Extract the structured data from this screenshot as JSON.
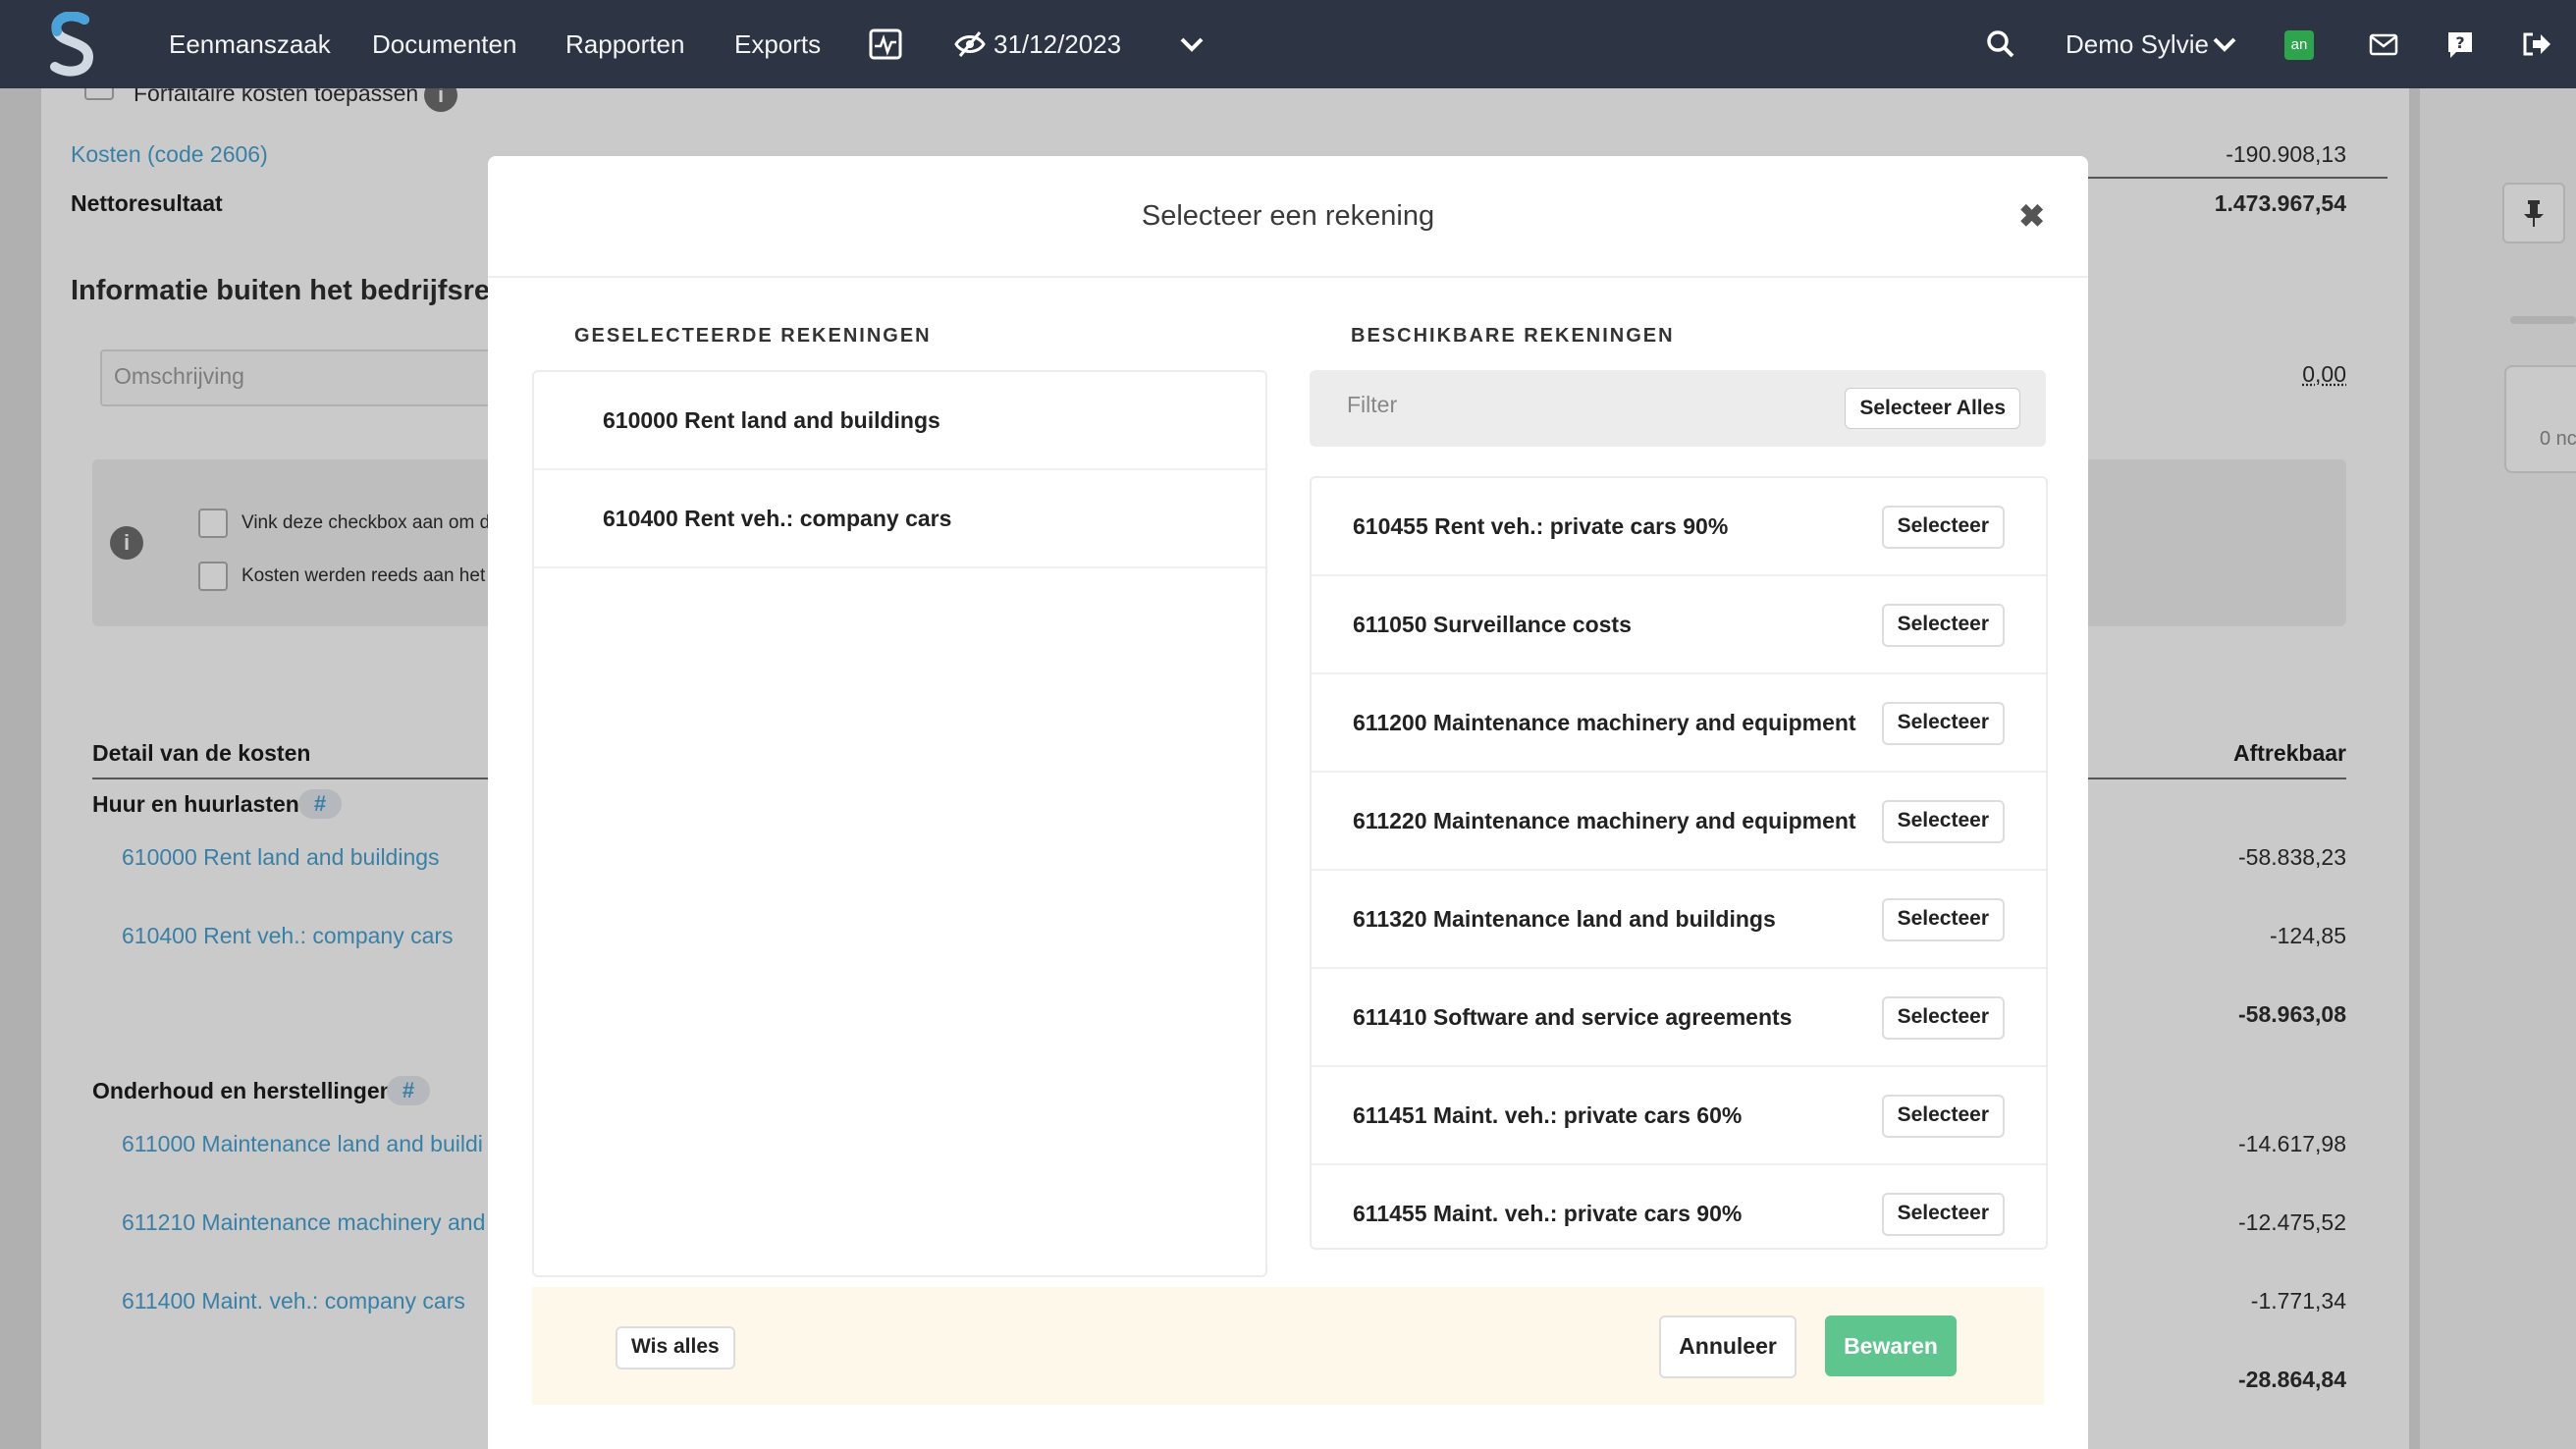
{
  "nav": {
    "items": [
      "Eenmanszaak",
      "Documenten",
      "Rapporten",
      "Exports"
    ],
    "date": "31/12/2023",
    "user": "Demo Sylvie",
    "badge": "an"
  },
  "background": {
    "forfaitaire": "Forfaitaire kosten toepassen",
    "kosten_link": "Kosten (code 2606)",
    "kosten_value": "-190.908,13",
    "netto_label": "Nettoresultaat",
    "netto_value": "1.473.967,54",
    "info_heading": "Informatie buiten het bedrijfsresult",
    "omschrijving_placeholder": "Omschrijving",
    "omschrijving_value": "0,00",
    "checkbox1": "Vink deze checkbox aan om d",
    "checkbox2": "Kosten werden reeds aan het",
    "detail_heading": "Detail van de kosten",
    "aftrekbaar": "Aftrekbaar",
    "group1": {
      "title": "Huur en huurlasten",
      "hash": "#",
      "rows": [
        {
          "label": "610000 Rent land and buildings",
          "value": "-58.838,23"
        },
        {
          "label": "610400 Rent veh.: company cars",
          "value": "-124,85"
        }
      ],
      "total": "-58.963,08"
    },
    "group2": {
      "title": "Onderhoud en herstellingen",
      "hash": "#",
      "rows": [
        {
          "label": "611000 Maintenance land and buildi",
          "value": "-14.617,98"
        },
        {
          "label": "611210 Maintenance machinery and",
          "value": "-12.475,52"
        },
        {
          "label": "611400 Maint. veh.: company cars",
          "value": "-1.771,34"
        }
      ],
      "total": "-28.864,84"
    },
    "side_text": "0 nc"
  },
  "modal": {
    "title": "Selecteer een rekening",
    "selected_heading": "GESELECTEERDE REKENINGEN",
    "available_heading": "BESCHIKBARE REKENINGEN",
    "filter_placeholder": "Filter",
    "select_all": "Selecteer Alles",
    "select_label": "Selecteer",
    "selected": [
      "610000 Rent land and buildings",
      "610400 Rent veh.: company cars"
    ],
    "available": [
      "610455 Rent veh.: private cars 90%",
      "611050 Surveillance costs",
      "611200 Maintenance machinery and equipment",
      "611220 Maintenance machinery and equipment",
      "611320 Maintenance land and buildings",
      "611410 Software and service agreements",
      "611451 Maint. veh.: private cars 60%",
      "611455 Maint. veh.: private cars 90%"
    ],
    "clear_all": "Wis alles",
    "cancel": "Annuleer",
    "save": "Bewaren"
  }
}
